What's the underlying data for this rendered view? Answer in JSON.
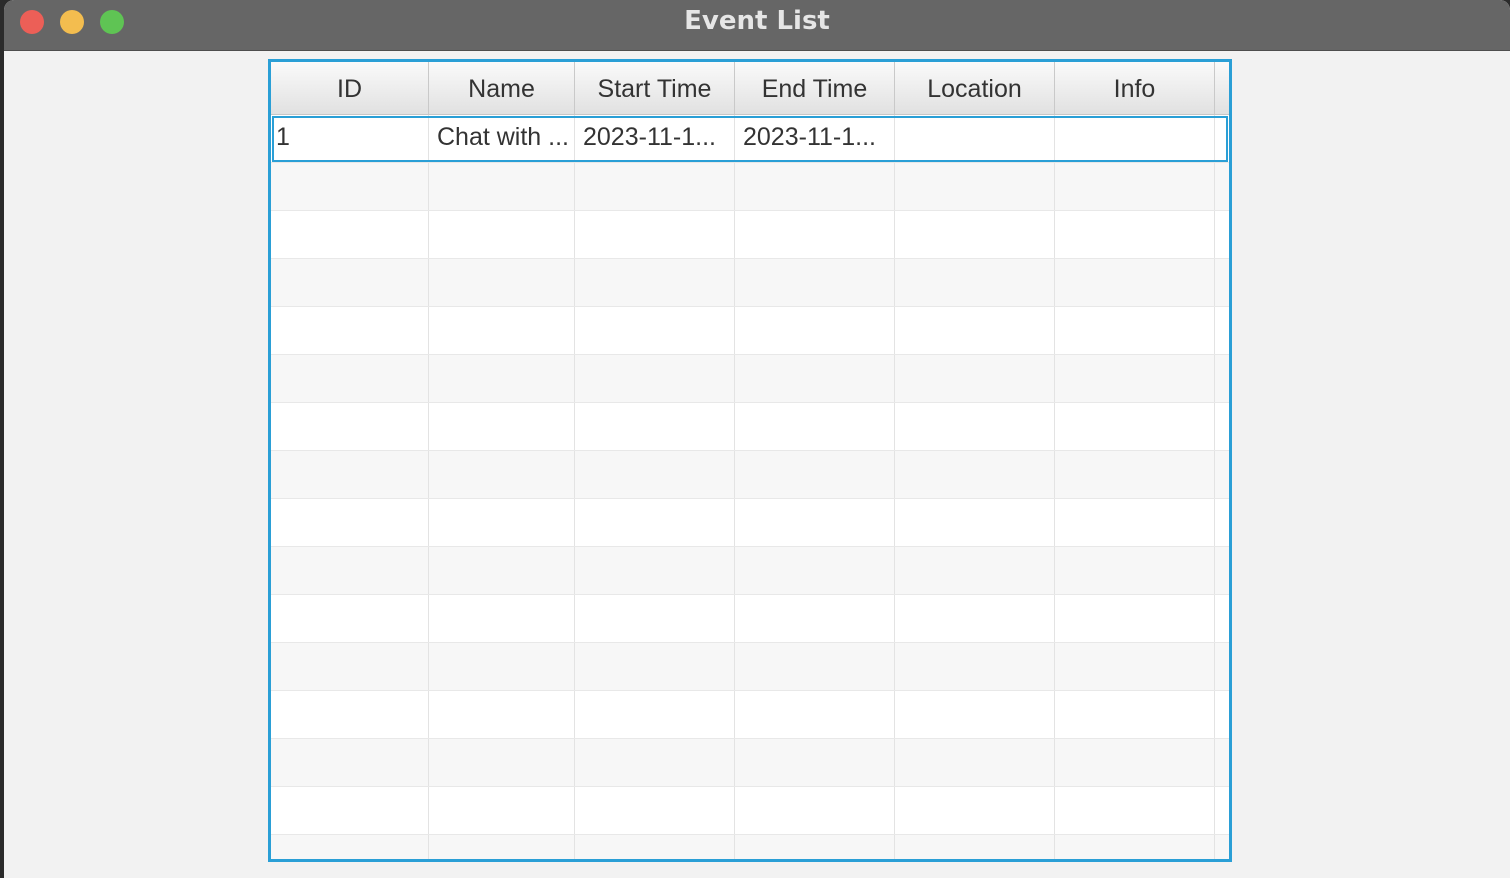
{
  "window": {
    "title": "Event List"
  },
  "table": {
    "columns": [
      "ID",
      "Name",
      "Start Time",
      "End Time",
      "Location",
      "Info"
    ],
    "rows": [
      [
        "1",
        "Chat with ...",
        "2023-11-1...",
        "2023-11-1...",
        "",
        ""
      ]
    ],
    "selected_row": 0
  },
  "colors": {
    "accent": "#2a9fd6",
    "titlebar": "#666666",
    "close": "#ec5f57",
    "minimize": "#f3bd4f",
    "maximize": "#5fc454"
  }
}
